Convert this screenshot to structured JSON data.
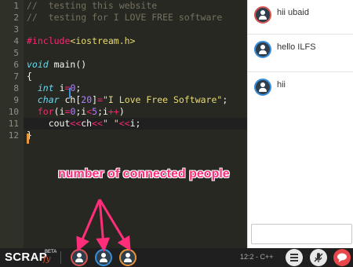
{
  "editor": {
    "line_numbers": [
      "1",
      "2",
      "3",
      "4",
      "5",
      "6",
      "7",
      "8",
      "9",
      "10",
      "11",
      "12"
    ],
    "lines": [
      [
        {
          "t": "//  testing this website",
          "c": "c-comment"
        }
      ],
      [
        {
          "t": "//  testing for I LOVE FREE software",
          "c": "c-comment"
        }
      ],
      [],
      [
        {
          "t": "#include",
          "c": "c-pre"
        },
        {
          "t": "<iostream.h>",
          "c": "c-inc"
        }
      ],
      [],
      [
        {
          "t": "void",
          "c": "c-type"
        },
        {
          "t": " main()",
          "c": "c-ident"
        }
      ],
      [
        {
          "t": "{",
          "c": "c-ident"
        }
      ],
      [
        {
          "t": "  ",
          "c": "c-ident"
        },
        {
          "t": "int",
          "c": "c-type"
        },
        {
          "t": " i",
          "c": "c-ident"
        },
        {
          "t": "=",
          "c": "c-op"
        },
        {
          "t": "0",
          "c": "c-num"
        },
        {
          "t": ";",
          "c": "c-ident"
        }
      ],
      [
        {
          "t": "  ",
          "c": "c-ident"
        },
        {
          "t": "char",
          "c": "c-type"
        },
        {
          "t": " ch[",
          "c": "c-ident"
        },
        {
          "t": "20",
          "c": "c-num"
        },
        {
          "t": "]",
          "c": "c-ident"
        },
        {
          "t": "=",
          "c": "c-op"
        },
        {
          "t": "\"I Love Free Software\"",
          "c": "c-str"
        },
        {
          "t": ";",
          "c": "c-ident"
        }
      ],
      [
        {
          "t": "  ",
          "c": "c-ident"
        },
        {
          "t": "for",
          "c": "c-kw"
        },
        {
          "t": "(i",
          "c": "c-ident"
        },
        {
          "t": "=",
          "c": "c-op"
        },
        {
          "t": "0",
          "c": "c-num"
        },
        {
          "t": ";i",
          "c": "c-ident"
        },
        {
          "t": "<",
          "c": "c-op"
        },
        {
          "t": "5",
          "c": "c-num"
        },
        {
          "t": ";i",
          "c": "c-ident"
        },
        {
          "t": "++",
          "c": "c-op"
        },
        {
          "t": ")",
          "c": "c-ident"
        }
      ],
      [
        {
          "t": "    cout",
          "c": "c-ident"
        },
        {
          "t": "<<",
          "c": "c-op"
        },
        {
          "t": "ch",
          "c": "c-ident"
        },
        {
          "t": "<<",
          "c": "c-op"
        },
        {
          "t": "\" \"",
          "c": "c-str"
        },
        {
          "t": "<<",
          "c": "c-op"
        },
        {
          "t": "i;",
          "c": "c-ident"
        }
      ],
      [
        {
          "t": "}",
          "c": "c-ident"
        }
      ]
    ]
  },
  "chat": {
    "messages": [
      {
        "text": "hii ubaid",
        "avatar_color": "red"
      },
      {
        "text": "hello ILFS",
        "avatar_color": "blue"
      },
      {
        "text": "hii",
        "avatar_color": "blue"
      }
    ],
    "input_value": ""
  },
  "footer": {
    "logo": "SCRAP",
    "logo_suffix": "fy",
    "beta": "BETA",
    "connected_users": [
      {
        "color": "red"
      },
      {
        "color": "blue"
      },
      {
        "color": "orange"
      }
    ],
    "status": "12:2 - C++",
    "buttons": {
      "menu_icon": "menu-icon",
      "mic_icon": "mic-muted-icon",
      "chat_icon": "chat-bubble-icon"
    }
  },
  "annotation": {
    "text": "number of connected people"
  },
  "colors": {
    "editor_bg": "#272822",
    "accent_pink": "#ff2d7a",
    "chat_button": "#e8484b"
  }
}
